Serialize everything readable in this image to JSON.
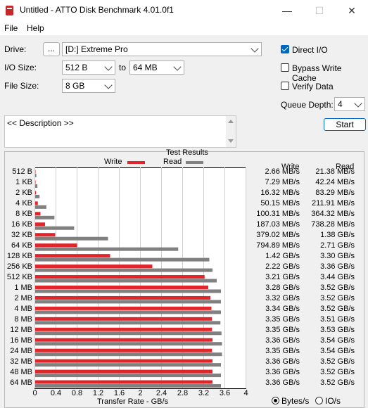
{
  "window": {
    "title": "Untitled - ATTO Disk Benchmark 4.01.0f1"
  },
  "menu": [
    "File",
    "Help"
  ],
  "controls": {
    "drive_label": "Drive:",
    "browse_label": "...",
    "drive_value": "[D:] Extreme Pro",
    "io_size_label": "I/O Size:",
    "io_from": "512 B",
    "io_to_word": "to",
    "io_to": "64 MB",
    "file_size_label": "File Size:",
    "file_size": "8 GB",
    "direct_io": "Direct I/O",
    "bypass_write_cache": "Bypass Write Cache",
    "verify_data": "Verify Data",
    "queue_depth_label": "Queue Depth:",
    "queue_depth": "4",
    "start_label": "Start",
    "description": "<< Description >>"
  },
  "results": {
    "title": "Test Results",
    "legend_write": "Write",
    "legend_read": "Read",
    "col_write": "Write",
    "col_read": "Read",
    "xlabel": "Transfer Rate - GB/s",
    "unit_bytes": "Bytes/s",
    "unit_io": "IO/s"
  },
  "chart_data": {
    "type": "bar",
    "categories": [
      "512 B",
      "1 KB",
      "2 KB",
      "4 KB",
      "8 KB",
      "16 KB",
      "32 KB",
      "64 KB",
      "128 KB",
      "256 KB",
      "512 KB",
      "1 MB",
      "2 MB",
      "4 MB",
      "8 MB",
      "12 MB",
      "16 MB",
      "24 MB",
      "32 MB",
      "48 MB",
      "64 MB"
    ],
    "x_ticks": [
      "0",
      "0.4",
      "0.8",
      "1.2",
      "1.6",
      "2",
      "2.4",
      "2.8",
      "3.2",
      "3.6",
      "4"
    ],
    "xlim": [
      0,
      4
    ],
    "series": [
      {
        "name": "Write",
        "color": "#e0262b",
        "values": [
          0.00266,
          0.00729,
          0.01632,
          0.05015,
          0.10031,
          0.18703,
          0.37902,
          0.79489,
          1.42,
          2.22,
          3.21,
          3.28,
          3.32,
          3.34,
          3.35,
          3.35,
          3.36,
          3.35,
          3.36,
          3.36,
          3.36
        ]
      },
      {
        "name": "Read",
        "color": "#808080",
        "values": [
          0.02138,
          0.04224,
          0.08329,
          0.21191,
          0.36432,
          0.73828,
          1.38,
          2.71,
          3.3,
          3.36,
          3.44,
          3.52,
          3.52,
          3.52,
          3.51,
          3.53,
          3.54,
          3.54,
          3.52,
          3.52,
          3.52
        ]
      }
    ],
    "write_text": [
      "2.66 MB/s",
      "7.29 MB/s",
      "16.32 MB/s",
      "50.15 MB/s",
      "100.31 MB/s",
      "187.03 MB/s",
      "379.02 MB/s",
      "794.89 MB/s",
      "1.42 GB/s",
      "2.22 GB/s",
      "3.21 GB/s",
      "3.28 GB/s",
      "3.32 GB/s",
      "3.34 GB/s",
      "3.35 GB/s",
      "3.35 GB/s",
      "3.36 GB/s",
      "3.35 GB/s",
      "3.36 GB/s",
      "3.36 GB/s",
      "3.36 GB/s"
    ],
    "read_text": [
      "21.38 MB/s",
      "42.24 MB/s",
      "83.29 MB/s",
      "211.91 MB/s",
      "364.32 MB/s",
      "738.28 MB/s",
      "1.38 GB/s",
      "2.71 GB/s",
      "3.30 GB/s",
      "3.36 GB/s",
      "3.44 GB/s",
      "3.52 GB/s",
      "3.52 GB/s",
      "3.52 GB/s",
      "3.51 GB/s",
      "3.53 GB/s",
      "3.54 GB/s",
      "3.54 GB/s",
      "3.52 GB/s",
      "3.52 GB/s",
      "3.52 GB/s"
    ]
  }
}
